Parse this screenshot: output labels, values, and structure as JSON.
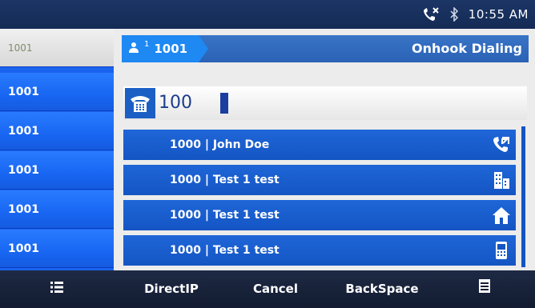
{
  "status": {
    "time": "10:55 AM",
    "icons": [
      "missed-call-icon",
      "bluetooth-icon"
    ]
  },
  "sidebar": {
    "items": [
      {
        "label": "1001"
      },
      {
        "label": "1001"
      },
      {
        "label": "1001"
      },
      {
        "label": "1001"
      },
      {
        "label": "1001"
      },
      {
        "label": "1001"
      }
    ]
  },
  "account": {
    "index": "1",
    "number": "1001",
    "mode": "Onhook Dialing"
  },
  "dial": {
    "input": "100"
  },
  "matches": [
    {
      "text": "1000 | John Doe",
      "icon": "call-log-icon"
    },
    {
      "text": "1000 | Test 1 test",
      "icon": "office-icon"
    },
    {
      "text": "1000 | Test 1 test",
      "icon": "home-icon"
    },
    {
      "text": "1000 | Test 1 test",
      "icon": "mobile-icon"
    }
  ],
  "softkeys": {
    "menu": "menu-list-icon",
    "directip": "DirectIP",
    "cancel": "Cancel",
    "backspace": "BackSpace",
    "more": "more-icon"
  },
  "colors": {
    "accent": "#1a63ee",
    "bar": "#2b62b6",
    "status": "#142b55"
  }
}
